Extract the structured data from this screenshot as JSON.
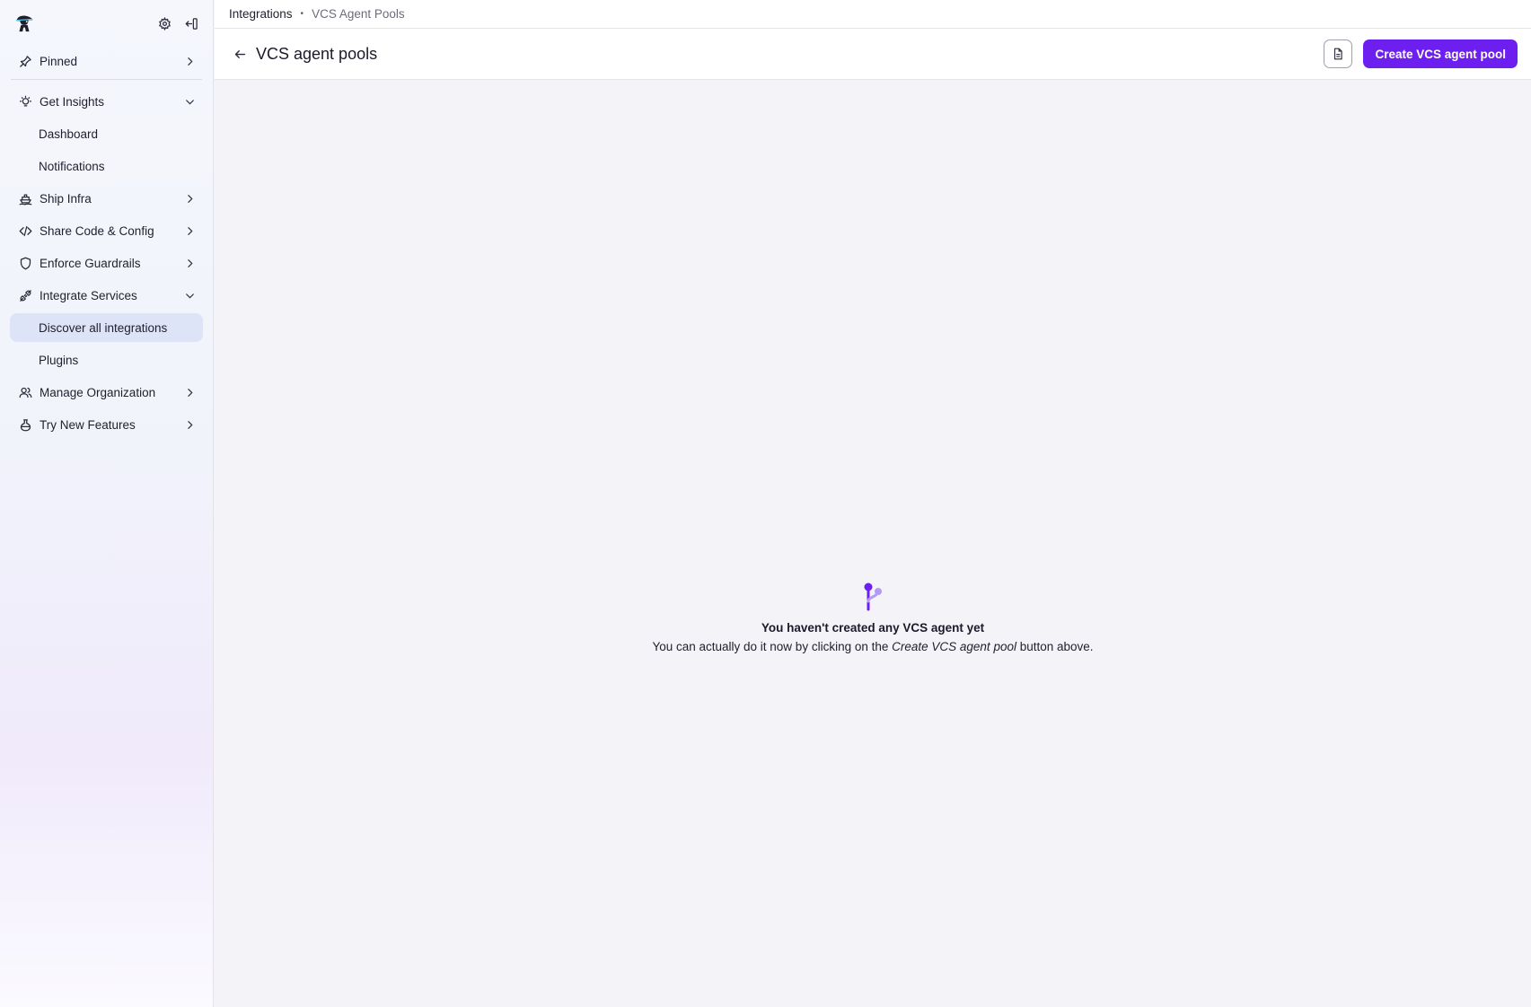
{
  "sidebar": {
    "pinned": {
      "label": "Pinned"
    },
    "sections": {
      "get_insights": {
        "label": "Get Insights",
        "items": [
          "Dashboard",
          "Notifications"
        ]
      },
      "ship_infra": {
        "label": "Ship Infra"
      },
      "share_code": {
        "label": "Share Code & Config"
      },
      "enforce_guardrails": {
        "label": "Enforce Guardrails"
      },
      "integrate_services": {
        "label": "Integrate Services",
        "items": [
          "Discover all integrations",
          "Plugins"
        ]
      },
      "manage_org": {
        "label": "Manage Organization"
      },
      "try_new": {
        "label": "Try New Features"
      }
    }
  },
  "breadcrumb": {
    "parent": "Integrations",
    "separator": "•",
    "current": "VCS Agent Pools"
  },
  "header": {
    "title": "VCS agent pools",
    "create_button": "Create VCS agent pool"
  },
  "empty_state": {
    "title": "You haven't created any VCS agent yet",
    "desc_before": "You can actually do it now by clicking on the ",
    "desc_em": "Create VCS agent pool",
    "desc_after": " button above."
  },
  "colors": {
    "accent": "#6d1ff0",
    "active_nav": "#dde4f7"
  },
  "icons": {
    "logo": "spacelift-logo-icon",
    "settings": "gear-icon",
    "collapse": "collapse-sidebar-icon",
    "pinned": "pin-icon",
    "insights": "lightbulb-icon",
    "ship": "ship-icon",
    "code": "code-icon",
    "guardrails": "shield-icon",
    "integrate": "plug-icon",
    "org": "users-icon",
    "features": "flask-icon",
    "back": "arrow-left-icon",
    "doc": "document-icon",
    "empty": "git-branch-icon"
  }
}
